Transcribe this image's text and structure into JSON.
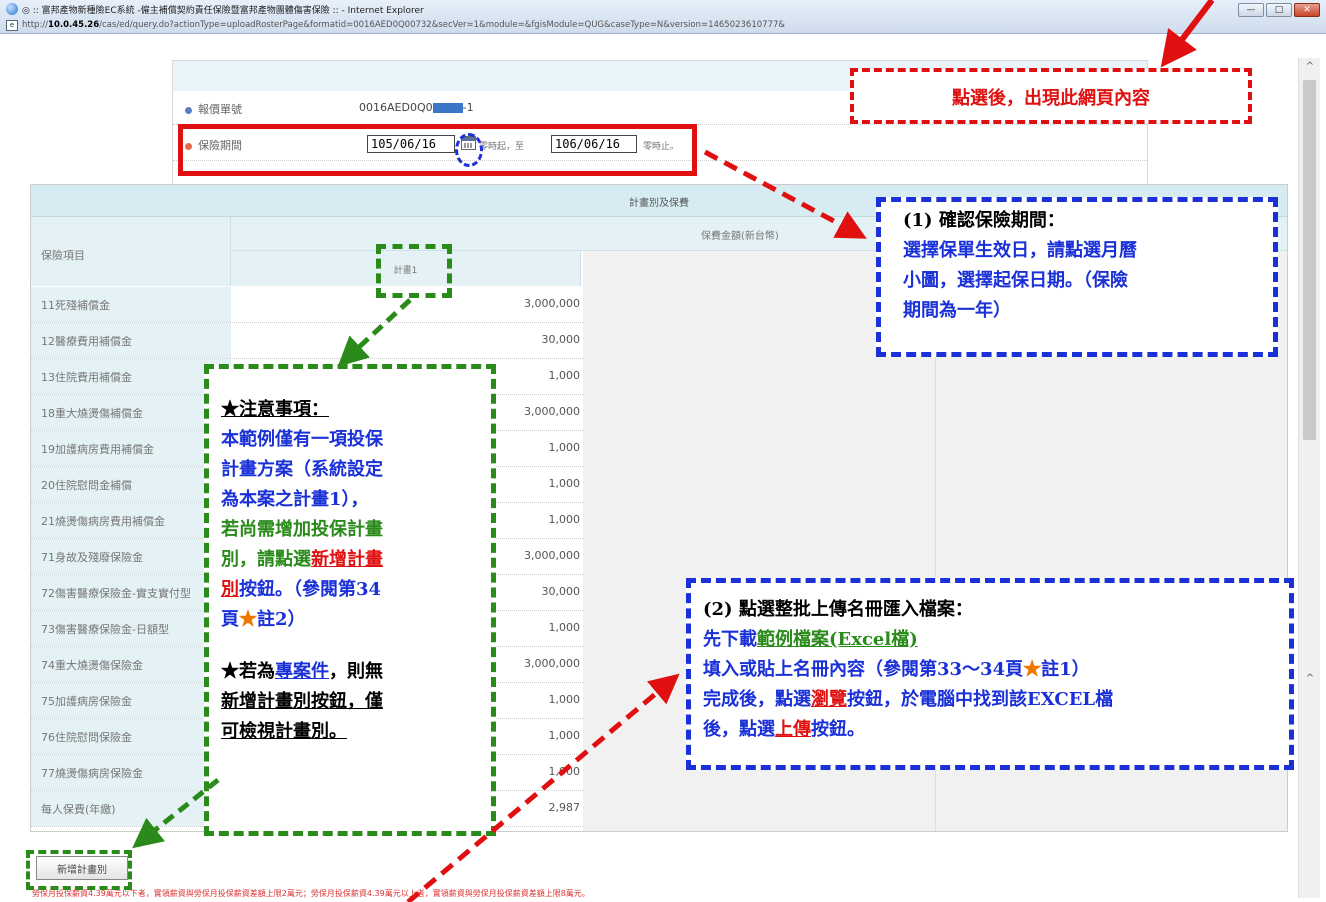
{
  "window": {
    "title": "◎ :: 富邦產物新種險EC系統 -僱主補償契約責任保險暨富邦產物團體傷害保險 :: - Internet Explorer",
    "address_prefix": "http://",
    "address_host": "10.0.45.26",
    "address_path": "/cas/ed/query.do?actionType=uploadRosterPage&formatid=0016AED0Q00732&secVer=1&module=&fgisModule=QUG&caseType=N&version=1465023610777&",
    "minimize_label": "—",
    "maximize_label": "□",
    "close_label": "✕"
  },
  "info": {
    "quote_label": "報價單號",
    "quote_prefix": "0016AED0Q0",
    "quote_suffix": "-1",
    "period_label": "保險期間",
    "start_date": "105/06/16",
    "start_suffix": "零時起，至",
    "end_date": "106/06/16",
    "end_suffix": "零時止。"
  },
  "table": {
    "section_title": "計畫別及保費",
    "item_col": "保險項目",
    "amount_col": "保費金額(新台幣)",
    "plan_col": "計畫1",
    "rows": [
      {
        "name": "11死殘補償金",
        "value": "3,000,000"
      },
      {
        "name": "12醫療費用補償金",
        "value": "30,000"
      },
      {
        "name": "13住院費用補償金",
        "value": "1,000"
      },
      {
        "name": "18重大燒燙傷補償金",
        "value": "3,000,000"
      },
      {
        "name": "19加護病房費用補償金",
        "value": "1,000"
      },
      {
        "name": "20住院慰問金補償",
        "value": "1,000"
      },
      {
        "name": "21燒燙傷病房費用補償金",
        "value": "1,000"
      },
      {
        "name": "71身故及殘廢保險金",
        "value": "3,000,000"
      },
      {
        "name": "72傷害醫療保險金-實支實付型",
        "value": "30,000"
      },
      {
        "name": "73傷害醫療保險金-日額型",
        "value": "1,000"
      },
      {
        "name": "74重大燒燙傷保險金",
        "value": "3,000,000"
      },
      {
        "name": "75加護病房保險金",
        "value": "1,000"
      },
      {
        "name": "76住院慰問保險金",
        "value": "1,000"
      },
      {
        "name": "77燒燙傷病房保險金",
        "value": "1,000"
      },
      {
        "name": "每人保費(年繳)",
        "value": "2,987"
      }
    ]
  },
  "add_plan_button": "新增計畫別",
  "footnote": "勞保月投保薪資4.39萬元以下者，實領薪資與勞保月投保薪資差額上限2萬元；勞保月投保薪資4.39萬元以上者，實領薪資與勞保月投保薪資差額上限8萬元。",
  "annotations": {
    "top_note": "點選後，出現此網頁內容",
    "note1": {
      "line1": "(1) 確認保險期間：",
      "line2": "選擇保單生效日，請點選月曆",
      "line3": "小圖，選擇起保日期。（保險",
      "line4": "期間為一年）"
    },
    "note2": {
      "line1": "(2) 點選整批上傳名冊匯入檔案：",
      "line2a": "先下載",
      "line2b": "範例檔案(Excel檔)",
      "line3a": "填入或貼上名冊內容（參閱第33～34頁",
      "line3b": "★",
      "line3c": "註1）",
      "line4a": "完成後，點選",
      "line4b": "瀏覽",
      "line4c": "按鈕，於電腦中找到該EXCEL檔",
      "line5a": "後，點選",
      "line5b": "上傳",
      "line5c": "按鈕。"
    },
    "note3": {
      "head": "★注意事項：",
      "l1": "本範例僅有一項投保",
      "l2": "計畫方案（系統設定",
      "l3": "為本案之計畫1），",
      "l4": "若尚需增加投保計畫",
      "l5a": "別，請點選",
      "l5b": "新增計畫",
      "l6a": "別",
      "l6b": "按鈕。（參閱第34",
      "l7a": "頁",
      "l7b": "★",
      "l7c": "註2）",
      "l8a": "★若為",
      "l8b": "專案件",
      "l8c": "，則無",
      "l9": "新增計畫別按鈕，僅",
      "l10": "可檢視計畫別。"
    }
  },
  "scrollbar": {
    "up": "^",
    "down": "^"
  }
}
